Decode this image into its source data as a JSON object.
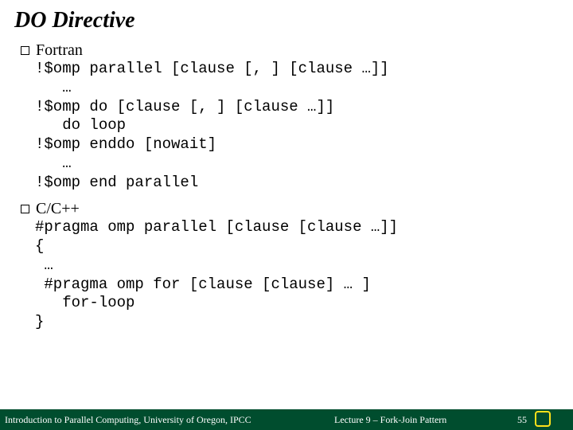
{
  "title": "DO Directive",
  "sections": [
    {
      "label": "Fortran",
      "code": "!$omp parallel [clause [, ] [clause …]]\n   …\n!$omp do [clause [, ] [clause …]]\n   do loop\n!$omp enddo [nowait]\n   …\n!$omp end parallel"
    },
    {
      "label": "C/C++",
      "code": "#pragma omp parallel [clause [clause …]]\n{\n …\n #pragma omp for [clause [clause] … ]\n   for-loop\n}"
    }
  ],
  "footer": {
    "left": "Introduction to Parallel Computing, University of Oregon, IPCC",
    "center": "Lecture 9 – Fork-Join Pattern",
    "pagenum": "55"
  }
}
